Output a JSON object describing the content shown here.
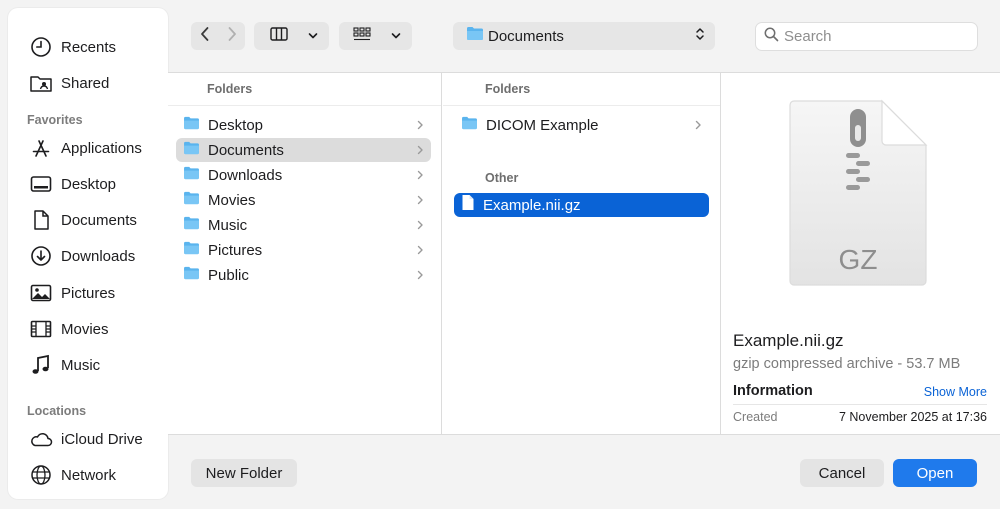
{
  "sidebar": {
    "items_top": [
      {
        "label": "Recents",
        "icon": "clock-icon"
      },
      {
        "label": "Shared",
        "icon": "shared-folder-icon"
      }
    ],
    "favorites_title": "Favorites",
    "favorites": [
      {
        "label": "Applications",
        "icon": "applications-icon"
      },
      {
        "label": "Desktop",
        "icon": "desktop-icon"
      },
      {
        "label": "Documents",
        "icon": "document-icon"
      },
      {
        "label": "Downloads",
        "icon": "download-icon"
      },
      {
        "label": "Pictures",
        "icon": "photo-icon"
      },
      {
        "label": "Movies",
        "icon": "film-icon"
      },
      {
        "label": "Music",
        "icon": "music-note-icon"
      }
    ],
    "locations_title": "Locations",
    "locations": [
      {
        "label": "iCloud Drive",
        "icon": "cloud-icon"
      },
      {
        "label": "Network",
        "icon": "globe-icon"
      }
    ]
  },
  "toolbar": {
    "path": "Documents",
    "search_placeholder": "Search"
  },
  "column1": {
    "header": "Folders",
    "items": [
      "Desktop",
      "Documents",
      "Downloads",
      "Movies",
      "Music",
      "Pictures",
      "Public"
    ],
    "selected": "Documents"
  },
  "column2": {
    "header": "Folders",
    "folders": [
      "DICOM Example"
    ],
    "other_header": "Other",
    "files": [
      "Example.nii.gz"
    ],
    "selected": "Example.nii.gz"
  },
  "preview": {
    "icon_label": "GZ",
    "name": "Example.nii.gz",
    "kind": "gzip compressed archive - 53.7 MB",
    "info_title": "Information",
    "show_more": "Show More",
    "created_label": "Created",
    "created_value": "7 November 2025 at 17:36"
  },
  "buttons": {
    "new_folder": "New Folder",
    "cancel": "Cancel",
    "open": "Open"
  },
  "colors": {
    "accent": "#1f7aec",
    "selection": "#0a63d6",
    "folder": "#5ab4ee"
  }
}
